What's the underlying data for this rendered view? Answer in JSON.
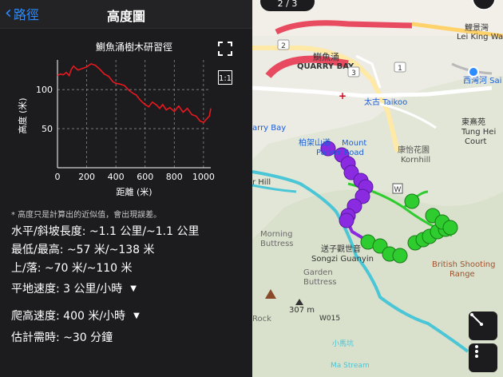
{
  "nav": {
    "back_label": "路徑",
    "title": "高度圖"
  },
  "chart_data": {
    "type": "line",
    "title": "鰂魚涌樹木研習徑",
    "xlabel": "距離 (米)",
    "ylabel": "高度 (米)",
    "xlim": [
      0,
      1050
    ],
    "ylim": [
      0,
      138
    ],
    "x_ticks": [
      "0",
      "200",
      "400",
      "600",
      "800",
      "1000"
    ],
    "y_ticks": [
      "50",
      "100"
    ],
    "grid": true,
    "line_color": "#e8181e",
    "x": [
      0,
      20,
      40,
      60,
      80,
      95,
      110,
      140,
      170,
      200,
      230,
      260,
      290,
      320,
      350,
      380,
      400,
      430,
      460,
      490,
      520,
      540,
      560,
      580,
      600,
      625,
      650,
      680,
      700,
      720,
      745,
      770,
      800,
      830,
      860,
      890,
      920,
      950,
      975,
      1000,
      1020,
      1040,
      1050
    ],
    "y": [
      118,
      120,
      119,
      122,
      118,
      126,
      130,
      125,
      127,
      129,
      133,
      131,
      126,
      120,
      117,
      110,
      108,
      107,
      105,
      99,
      95,
      93,
      88,
      84,
      81,
      78,
      84,
      80,
      76,
      81,
      74,
      77,
      72,
      79,
      71,
      76,
      68,
      66,
      60,
      58,
      62,
      66,
      76
    ]
  },
  "buttons": {
    "fullscreen_icon": "fullscreen-icon",
    "ratio_label": "1:1"
  },
  "note": "* 高度只是計算出的近似值，會出現誤差。",
  "stats": {
    "distance": "水平/斜坡長度: ~1.1 公里/~1.1 公里",
    "minmax": "最低/最高: ~57 米/~138 米",
    "updown": "上/落: ~70 米/~110 米"
  },
  "dropdowns": {
    "flat_speed": "平地速度: 3 公里/小時",
    "climb_speed": "爬高速度: 400 米/小時"
  },
  "estimate": "估計需時: ~30 分鐘",
  "map": {
    "top_badge": "2 / 3",
    "labels": {
      "quarry_bay_cn": "鰂魚涌",
      "quarry_bay_en": "QUARRY BAY",
      "lee_cn": "鯉景灣",
      "lee_en": "Lei King Wa",
      "sai_wan_ho": "西灣河 Sai",
      "taikoo": "太古 Taikoo",
      "quarry_bay_partial": "arry Bay",
      "parker_cn": "柏架山道",
      "parker_en1": "Mount",
      "parker_en2": "Parker Road",
      "kornhill_cn": "康怡花園",
      "kornhill_en": "Kornhill",
      "tung_hei_cn": "東熹苑",
      "tung_hei_en1": "Tung Hei",
      "tung_hei_en2": "Court",
      "hill": "r Hill",
      "morning_1": "Morning",
      "morning_2": "Buttress",
      "songzi_cn": "送子觀世音",
      "songzi_en": "Songzi Guanyin",
      "british_1": "British Shooting",
      "british_2": "Range",
      "garden_1": "Garden",
      "garden_2": "Buttress",
      "peak": "307 m",
      "w015": "W015",
      "rock": "Rock",
      "stream_cn": "小馬坑",
      "stream_en": "Ma Stream",
      "w_marker": "W",
      "num_2": "2",
      "num_1": "1",
      "num_3": "3"
    },
    "route_color": "#8a2be2",
    "trail_color": "#2ecc2e",
    "water_color": "#4ac6d6"
  }
}
